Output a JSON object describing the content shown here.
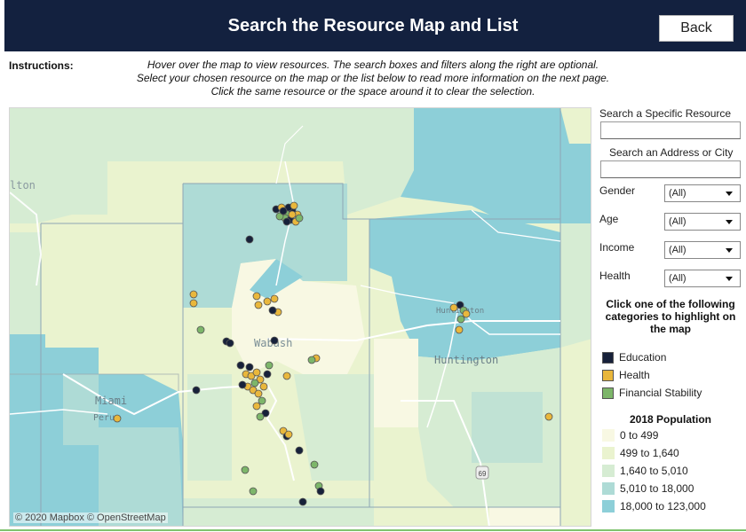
{
  "header": {
    "title": "Search the Resource Map and List",
    "back_label": "Back"
  },
  "instructions": {
    "label": "Instructions:",
    "line1": "Hover over the map to view resources. The search boxes and filters along the right are optional.",
    "line2": "Select your chosen resource on the map or the list below to read more information on the next page.",
    "line3": "Click the same resource or the space around it to clear the selection."
  },
  "map": {
    "attribution": "© 2020 Mapbox  © OpenStreetMap",
    "place_labels": [
      "lton",
      "Wabash",
      "Huntington",
      "Huntington",
      "Miami",
      "Peru"
    ],
    "highway_shield": "69"
  },
  "search": {
    "resource_label": "Search a Specific Resource",
    "resource_value": "",
    "address_label": "Search an Address or City",
    "address_value": ""
  },
  "filters": [
    {
      "label": "Gender",
      "value": "(All)"
    },
    {
      "label": "Age",
      "value": "(All)"
    },
    {
      "label": "Income",
      "value": "(All)"
    },
    {
      "label": "Health",
      "value": "(All)"
    }
  ],
  "categories": {
    "heading": "Click one of the following categories to highlight on the map",
    "items": [
      {
        "label": "Education",
        "color": "#17213a"
      },
      {
        "label": "Health",
        "color": "#e9b73c"
      },
      {
        "label": "Financial Stability",
        "color": "#7db66a"
      }
    ]
  },
  "population": {
    "title": "2018 Population",
    "bins": [
      {
        "label": "0 to 499",
        "color": "#f8f8e3"
      },
      {
        "label": "499 to 1,640",
        "color": "#eaf3cf"
      },
      {
        "label": "1,640 to 5,010",
        "color": "#d6ecd3"
      },
      {
        "label": "5,010 to 18,000",
        "color": "#aedbd6"
      },
      {
        "label": "18,000 to 123,000",
        "color": "#8dcfd8"
      }
    ]
  }
}
